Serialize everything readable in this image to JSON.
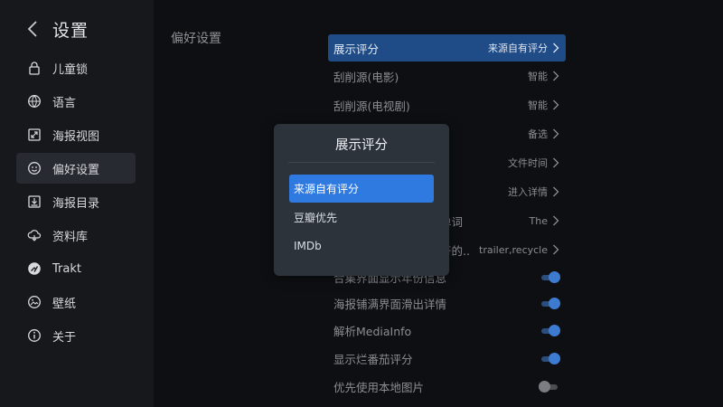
{
  "sidebar": {
    "title": "设置",
    "items": [
      {
        "label": "儿童锁",
        "icon": "lock-icon"
      },
      {
        "label": "语言",
        "icon": "globe-icon"
      },
      {
        "label": "海报视图",
        "icon": "poster-view-icon"
      },
      {
        "label": "偏好设置",
        "icon": "smiley-icon",
        "active": true
      },
      {
        "label": "海报目录",
        "icon": "download-folder-icon"
      },
      {
        "label": "资料库",
        "icon": "cloud-library-icon"
      },
      {
        "label": "Trakt",
        "icon": "trakt-icon"
      },
      {
        "label": "壁纸",
        "icon": "image-icon"
      },
      {
        "label": "关于",
        "icon": "info-icon"
      }
    ]
  },
  "main": {
    "section_title": "偏好设置",
    "rows": [
      {
        "label": "展示评分",
        "value": "来源自有评分"
      },
      {
        "label": "刮削源(电影)",
        "value": "智能"
      },
      {
        "label": "刮削源(电视剧)",
        "value": "智能"
      },
      {
        "label": "",
        "value": "备选"
      },
      {
        "label": "",
        "value": "文件时间"
      },
      {
        "label": "",
        "value": "进入详情"
      },
      {
        "label": "单词",
        "value": "The"
      },
      {
        "label": "符的..",
        "value": "trailer,recycle"
      },
      {
        "label": "合集界面显示年份信息",
        "toggle": true
      },
      {
        "label": "海报铺满界面滑出详情",
        "toggle": true
      },
      {
        "label": "解析MediaInfo",
        "toggle": true
      },
      {
        "label": "显示烂番茄评分",
        "toggle": true
      },
      {
        "label": "优先使用本地图片",
        "toggle": false
      }
    ]
  },
  "dialog": {
    "title": "展示评分",
    "options": [
      {
        "label": "来源自有评分",
        "selected": true
      },
      {
        "label": "豆瓣优先"
      },
      {
        "label": "IMDb"
      }
    ]
  },
  "colors": {
    "accent": "#2f7ae0",
    "selected_row": "#1f4c87",
    "toggle_on": "#3d7bd1",
    "background": "#0d0f12",
    "sidebar": "#16181c",
    "dialog": "#2d333b"
  }
}
